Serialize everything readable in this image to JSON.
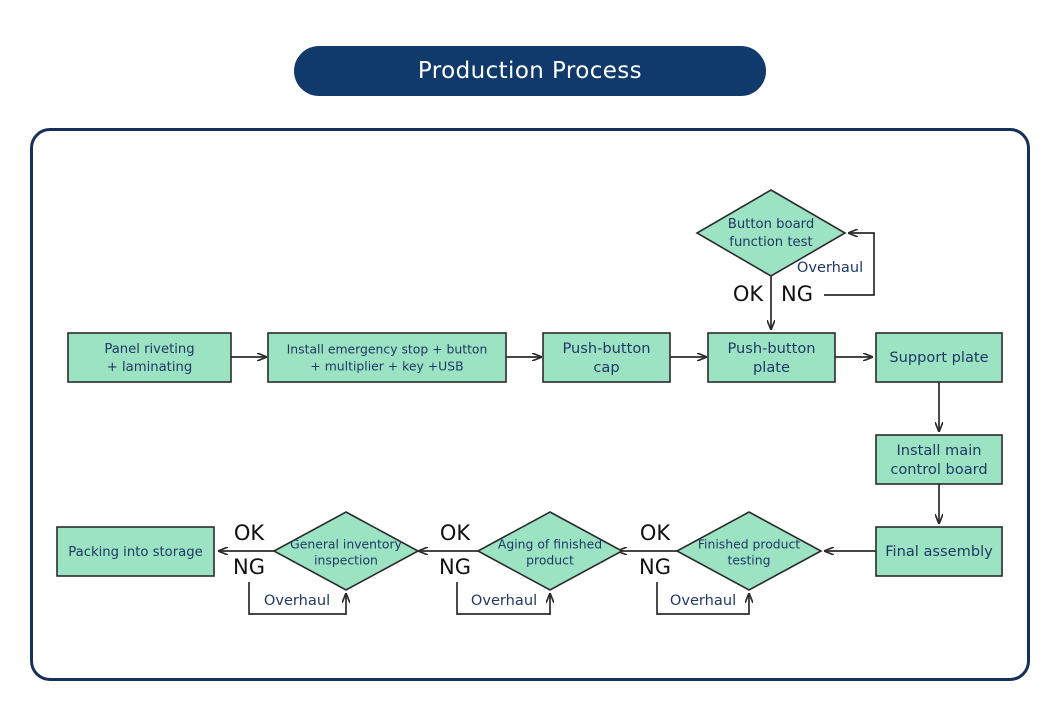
{
  "title": "Production Process",
  "colors": {
    "title_bar_bg": "#103a6b",
    "title_text": "#ffffff",
    "frame_border": "#16305c",
    "node_fill": "#9ce3c4",
    "node_stroke": "#2b2b2b",
    "node_text": "#203864",
    "decision_label_text": "#111111",
    "canvas_bg": "#ffffff"
  },
  "chart_data": {
    "type": "diagram",
    "title": "Production Process",
    "nodes": [
      {
        "id": "panel_riveting",
        "shape": "process",
        "label": "Panel riveting\n+ laminating",
        "line1": "Panel riveting",
        "line2": "+ laminating"
      },
      {
        "id": "install_estop",
        "shape": "process",
        "label": "Install emergency stop + button\n+ multiplier + key +USB",
        "line1": "Install emergency stop + button",
        "line2": "+ multiplier + key +USB"
      },
      {
        "id": "push_button_cap",
        "shape": "process",
        "label": "Push-button\ncap",
        "line1": "Push-button",
        "line2": "cap"
      },
      {
        "id": "button_board_test",
        "shape": "decision",
        "label": "Button board\nfunction test",
        "line1": "Button board",
        "line2": "function test"
      },
      {
        "id": "push_button_plate",
        "shape": "process",
        "label": "Push-button\nplate",
        "line1": "Push-button",
        "line2": "plate"
      },
      {
        "id": "support_plate",
        "shape": "process",
        "label": "Support plate",
        "line1": "Support plate",
        "line2": ""
      },
      {
        "id": "install_main_board",
        "shape": "process",
        "label": "Install main\ncontrol board",
        "line1": "Install main",
        "line2": "control board"
      },
      {
        "id": "final_assembly",
        "shape": "process",
        "label": "Final assembly",
        "line1": "Final assembly",
        "line2": ""
      },
      {
        "id": "finished_testing",
        "shape": "decision",
        "label": "Finished product\ntesting",
        "line1": "Finished product",
        "line2": "testing"
      },
      {
        "id": "aging_finished",
        "shape": "decision",
        "label": "Aging of  finished\nproduct",
        "line1": "Aging of  finished",
        "line2": "product"
      },
      {
        "id": "general_inventory",
        "shape": "decision",
        "label": "General inventory\ninspection",
        "line1": "General inventory",
        "line2": "inspection"
      },
      {
        "id": "packing_storage",
        "shape": "process",
        "label": "Packing into storage",
        "line1": "Packing into storage",
        "line2": ""
      }
    ],
    "edges": [
      {
        "from": "panel_riveting",
        "to": "install_estop",
        "label": ""
      },
      {
        "from": "install_estop",
        "to": "push_button_cap",
        "label": ""
      },
      {
        "from": "push_button_cap",
        "to": "push_button_plate",
        "label": ""
      },
      {
        "from": "button_board_test",
        "to": "push_button_plate",
        "label": "OK"
      },
      {
        "from": "button_board_test",
        "to": "button_board_test",
        "label": "NG",
        "loop_label": "Overhaul"
      },
      {
        "from": "push_button_plate",
        "to": "support_plate",
        "label": ""
      },
      {
        "from": "support_plate",
        "to": "install_main_board",
        "label": ""
      },
      {
        "from": "install_main_board",
        "to": "final_assembly",
        "label": ""
      },
      {
        "from": "final_assembly",
        "to": "finished_testing",
        "label": ""
      },
      {
        "from": "finished_testing",
        "to": "aging_finished",
        "label": "OK"
      },
      {
        "from": "finished_testing",
        "to": "finished_testing",
        "label": "NG",
        "loop_label": "Overhaul"
      },
      {
        "from": "aging_finished",
        "to": "general_inventory",
        "label": "OK"
      },
      {
        "from": "aging_finished",
        "to": "aging_finished",
        "label": "NG",
        "loop_label": "Overhaul"
      },
      {
        "from": "general_inventory",
        "to": "packing_storage",
        "label": "OK"
      },
      {
        "from": "general_inventory",
        "to": "general_inventory",
        "label": "NG",
        "loop_label": "Overhaul"
      }
    ],
    "labels": {
      "ok": "OK",
      "ng": "NG",
      "overhaul": "Overhaul"
    }
  }
}
